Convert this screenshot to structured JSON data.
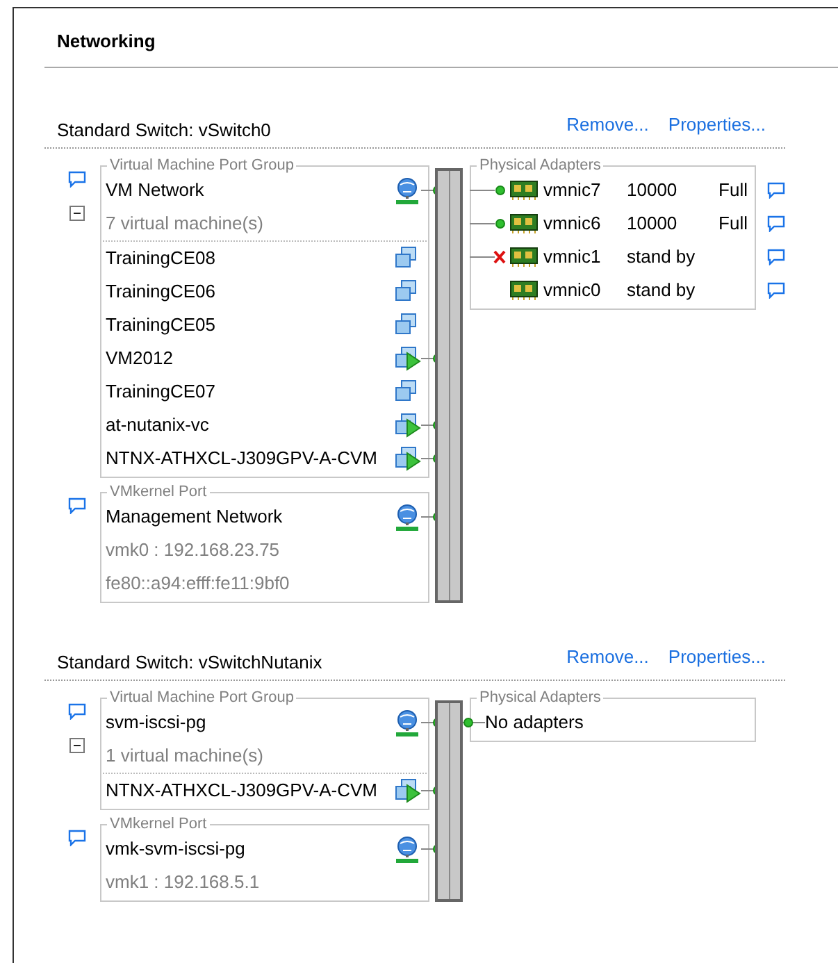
{
  "title": "Networking",
  "switches": [
    {
      "title": "Standard Switch: vSwitch0",
      "links": [
        "Remove...",
        "Properties..."
      ],
      "port_groups": [
        {
          "kind": "vm",
          "heading": "Virtual Machine Port Group",
          "name": "VM Network",
          "expanded": true,
          "count": "7 virtual machine(s)",
          "vms": [
            {
              "name": "TrainingCE08",
              "powered_on": false
            },
            {
              "name": "TrainingCE06",
              "powered_on": false
            },
            {
              "name": "TrainingCE05",
              "powered_on": false
            },
            {
              "name": "VM2012",
              "powered_on": true
            },
            {
              "name": "TrainingCE07",
              "powered_on": false
            },
            {
              "name": "at-nutanix-vc",
              "powered_on": true
            },
            {
              "name": "NTNX-ATHXCL-J309GPV-A-CVM",
              "powered_on": true
            }
          ]
        },
        {
          "kind": "vmkernel",
          "heading": "VMkernel Port",
          "name": "Management Network",
          "details": [
            "vmk0 : 192.168.23.75",
            "fe80::a94:efff:fe11:9bf0"
          ]
        }
      ],
      "adapters_heading": "Physical Adapters",
      "adapters": [
        {
          "name": "vmnic7",
          "speed": "10000",
          "duplex": "Full",
          "connected": true,
          "failed": false
        },
        {
          "name": "vmnic6",
          "speed": "10000",
          "duplex": "Full",
          "connected": true,
          "failed": false
        },
        {
          "name": "vmnic1",
          "speed": "stand by",
          "connected": false,
          "failed": true
        },
        {
          "name": "vmnic0",
          "speed": "stand by",
          "connected": false,
          "failed": false
        }
      ]
    },
    {
      "title": "Standard Switch: vSwitchNutanix",
      "links": [
        "Remove...",
        "Properties..."
      ],
      "port_groups": [
        {
          "kind": "vm",
          "heading": "Virtual Machine Port Group",
          "name": "svm-iscsi-pg",
          "expanded": true,
          "count": "1 virtual machine(s)",
          "vms": [
            {
              "name": "NTNX-ATHXCL-J309GPV-A-CVM",
              "powered_on": true
            }
          ]
        },
        {
          "kind": "vmkernel",
          "heading": "VMkernel Port",
          "name": "vmk-svm-iscsi-pg",
          "details": [
            "vmk1 : 192.168.5.1"
          ]
        }
      ],
      "adapters_heading": "Physical Adapters",
      "empty_adapters": "No adapters"
    }
  ]
}
